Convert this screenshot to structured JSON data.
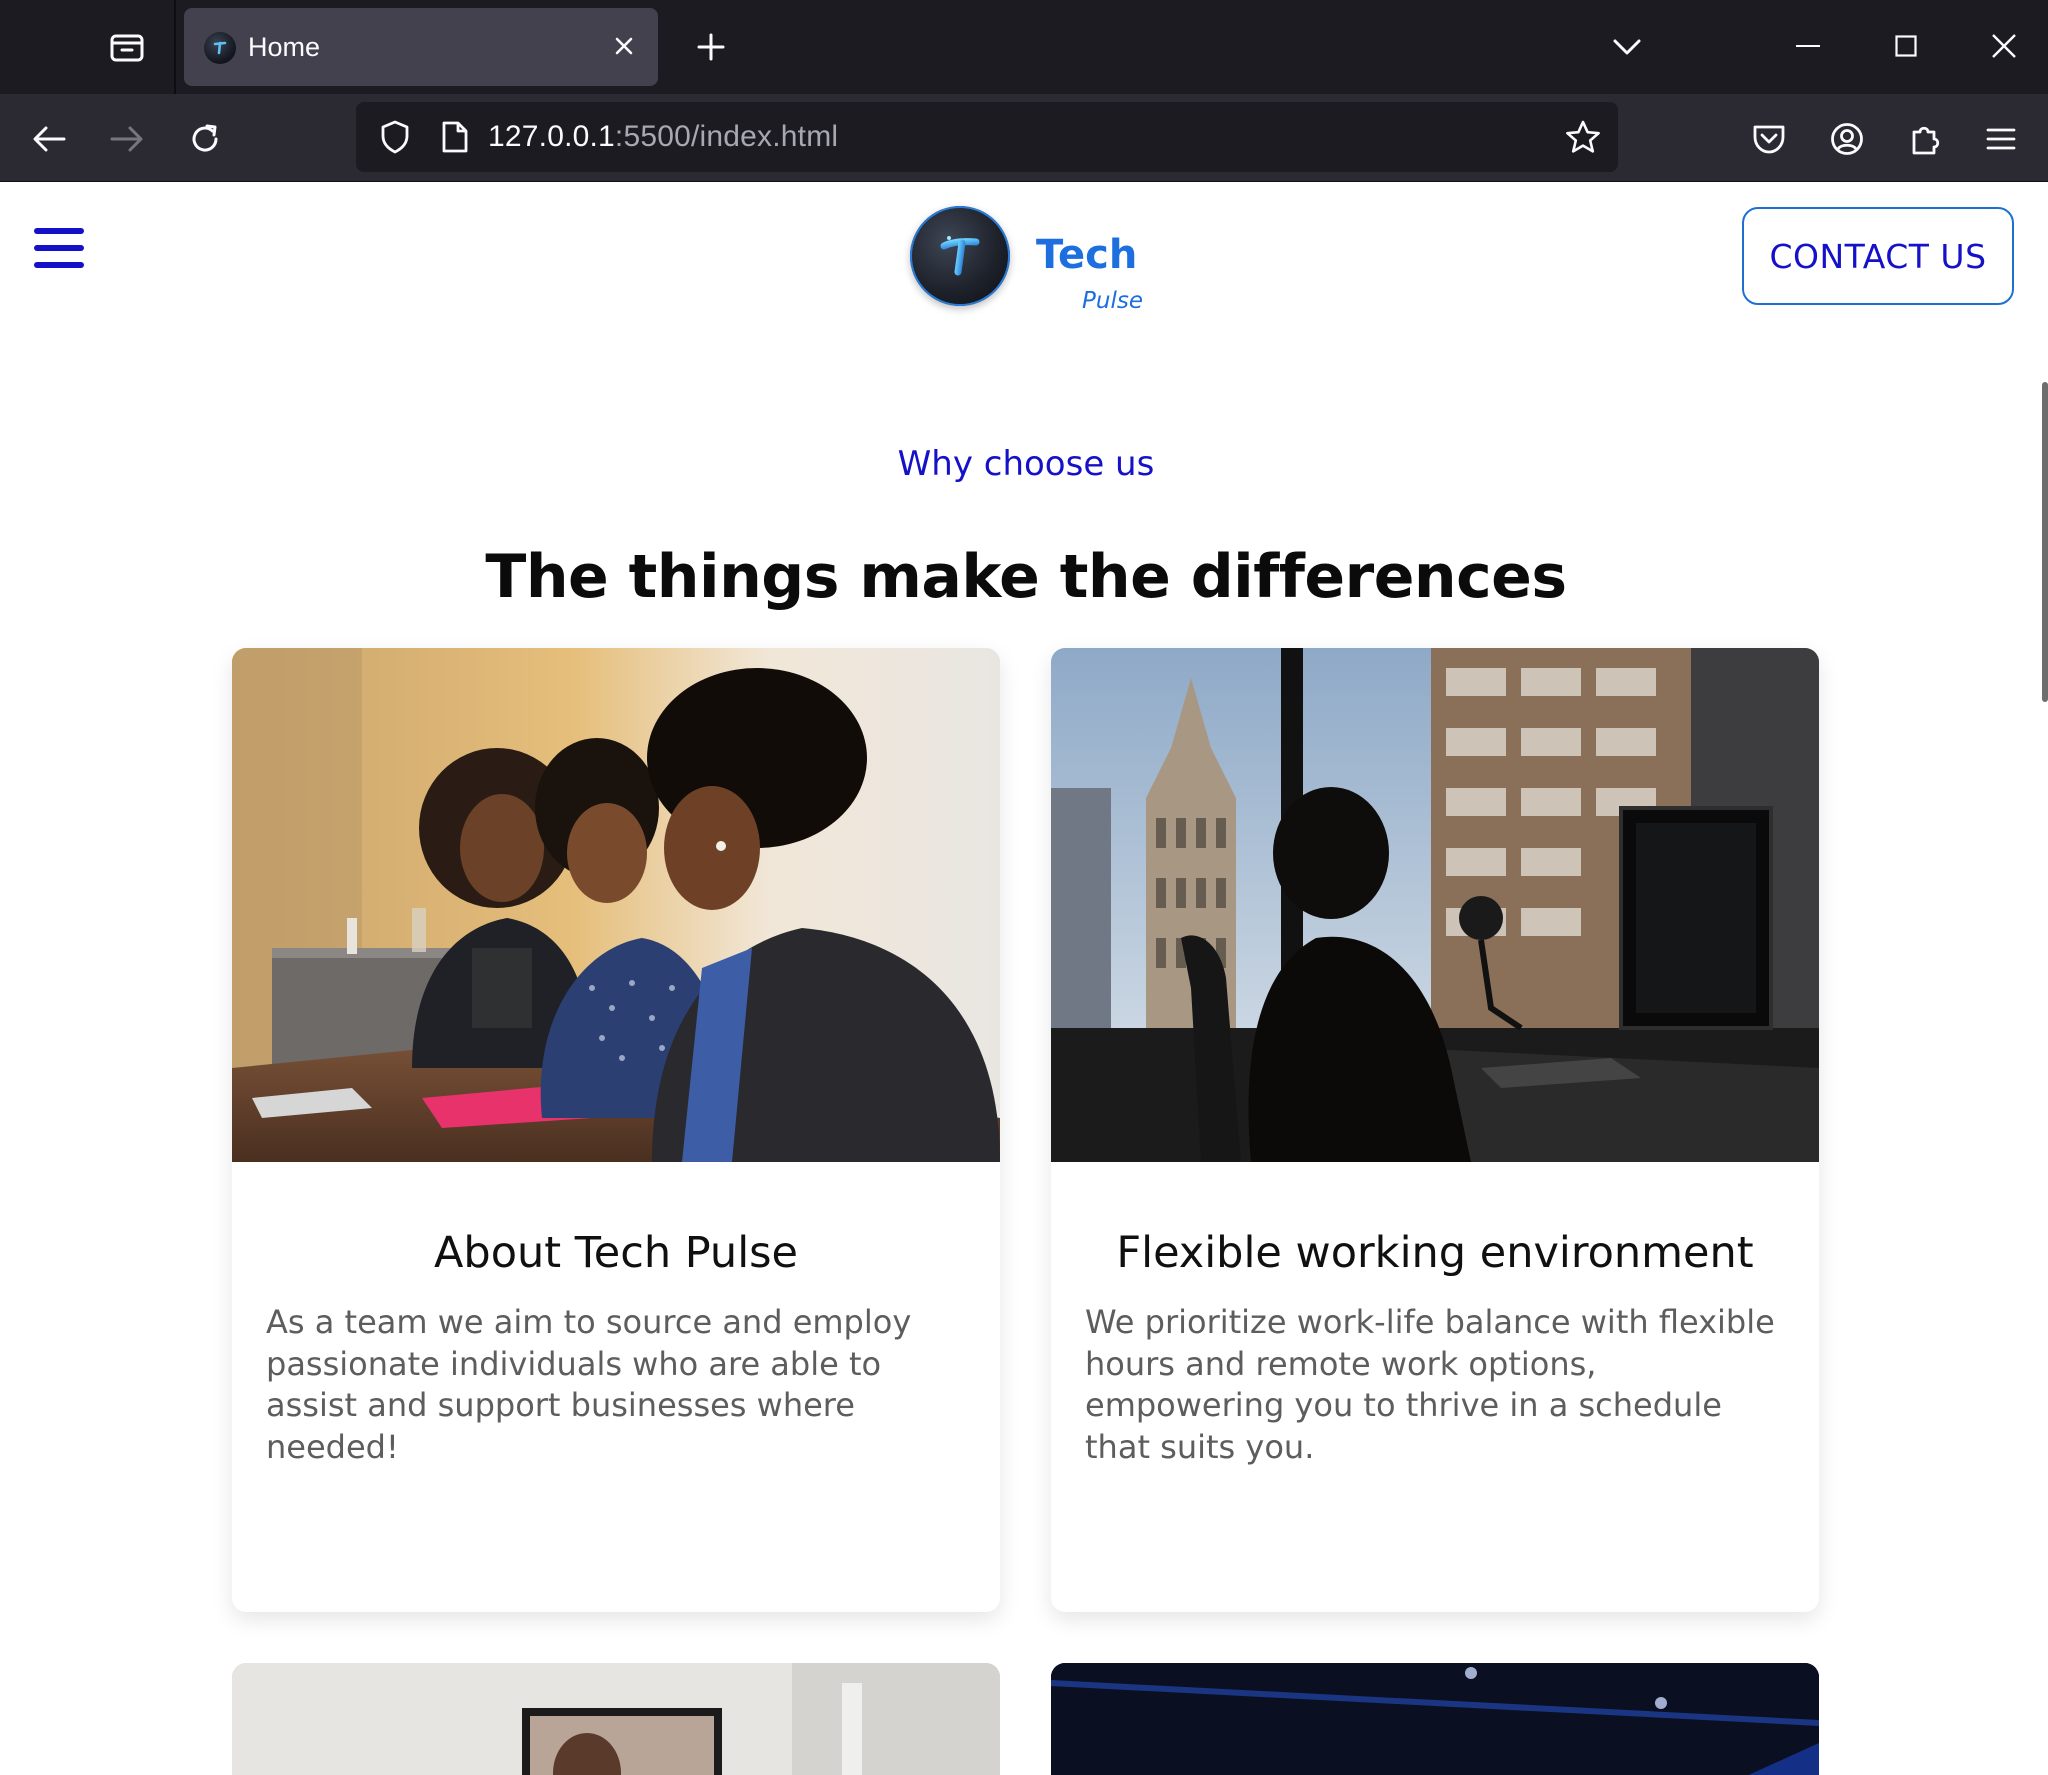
{
  "browser": {
    "tab_title": "Home",
    "url_host": "127.0.0.1",
    "url_rest": ":5500/index.html"
  },
  "site": {
    "logo_name": "Tech",
    "logo_tagline": "Pulse",
    "contact_label": "CONTACT US"
  },
  "section": {
    "eyebrow": "Why choose us",
    "headline": "The things make the differences"
  },
  "cards": [
    {
      "title": "About Tech Pulse",
      "body": "As a team we aim to source and employ passionate individuals who are able to assist and support businesses where needed!"
    },
    {
      "title": "Flexible working environment",
      "body": "We prioritize work-life balance with flexible hours and remote work options, empowering you to thrive in a schedule that suits you."
    }
  ],
  "colors": {
    "accent": "#1411c9",
    "brand_blue": "#1d6fe0",
    "chrome_dark": "#1c1b22",
    "chrome_toolbar": "#2b2a33",
    "tab_active": "#42414d"
  }
}
